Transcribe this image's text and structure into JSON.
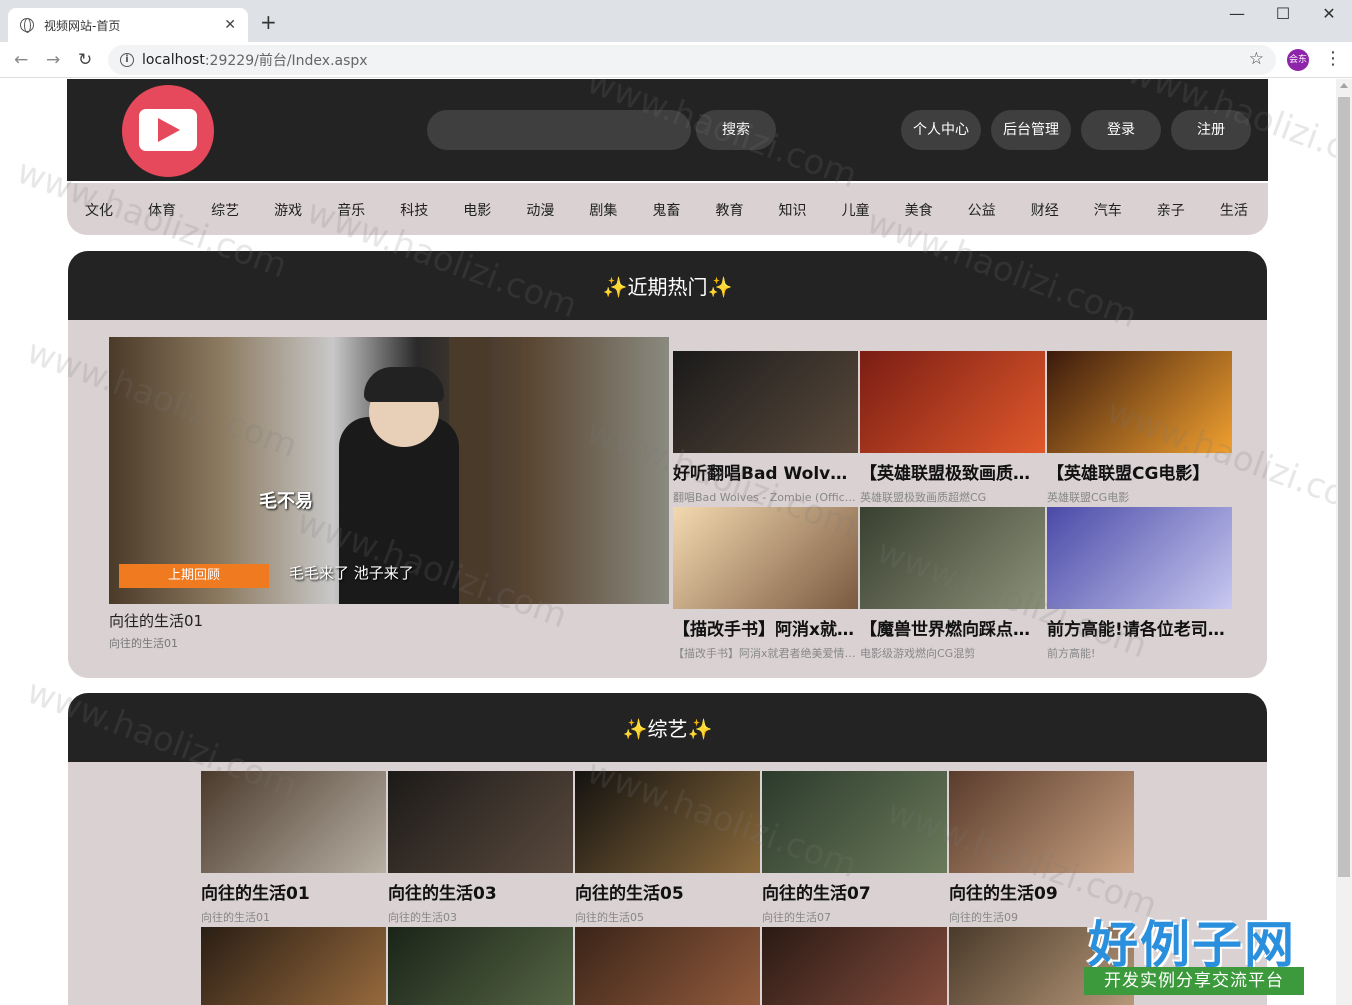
{
  "browser": {
    "tab_title": "视频网站-首页",
    "tab_close": "✕",
    "new_tab": "+",
    "url_host": "localhost",
    "url_rest": ":29229/前台/Index.aspx",
    "profile_label": "会东",
    "minimize": "—",
    "maximize": "☐",
    "close": "✕"
  },
  "header": {
    "search_placeholder": "",
    "search_button": "搜索",
    "user_center": "个人中心",
    "admin": "后台管理",
    "login": "登录",
    "register": "注册"
  },
  "categories": [
    "文化",
    "体育",
    "综艺",
    "游戏",
    "音乐",
    "科技",
    "电影",
    "动漫",
    "剧集",
    "鬼畜",
    "教育",
    "知识",
    "儿童",
    "美食",
    "公益",
    "财经",
    "汽车",
    "亲子",
    "生活"
  ],
  "hot": {
    "heading": "近期热门",
    "sparkle": "✨",
    "main": {
      "title": "向往的生活01",
      "subtitle": "向往的生活01",
      "overlay_badge": "上期回顾",
      "overlay_caption": "毛毛来了 池子来了",
      "overlay_tag": "毛不易"
    },
    "items": [
      {
        "title": "好听翻唱Bad Wolves - Zombie",
        "subtitle": "翻唱Bad Wolves - Zombie (Official)",
        "colors": [
          "#1a1a1a",
          "#5a4a3c"
        ]
      },
      {
        "title": "【英雄联盟极致画质燃向混剪】",
        "subtitle": "英雄联盟极致画质超燃CG",
        "colors": [
          "#7a1d14",
          "#e0592b"
        ]
      },
      {
        "title": "【英雄联盟CG电影】",
        "subtitle": "英雄联盟CG电影",
        "colors": [
          "#3b1a0c",
          "#f0a030"
        ]
      },
      {
        "title": "【描改手书】阿消x就君者绝美爱情",
        "subtitle": "【描改手书】阿消x就君者绝美爱情故事",
        "colors": [
          "#f3d9b0",
          "#7a5a40"
        ]
      },
      {
        "title": "【魔兽世界燃向踩点混剪】",
        "subtitle": "电影级游戏燃向CG混剪",
        "colors": [
          "#3a4030",
          "#8a9078"
        ]
      },
      {
        "title": "前方高能!请各位老司机坐稳",
        "subtitle": "前方高能!",
        "colors": [
          "#4a4aa8",
          "#c8c8f0"
        ]
      }
    ]
  },
  "variety": {
    "heading": "综艺",
    "sparkle": "✨",
    "items": [
      {
        "title": "向往的生活01",
        "subtitle": "向往的生活01",
        "colors": [
          "#4a3a2c",
          "#b8b0a4"
        ]
      },
      {
        "title": "向往的生活03",
        "subtitle": "向往的生活03",
        "colors": [
          "#1c1a18",
          "#5a4a3e"
        ]
      },
      {
        "title": "向往的生活05",
        "subtitle": "向往的生活05",
        "colors": [
          "#141210",
          "#8a6a3c"
        ]
      },
      {
        "title": "向往的生活07",
        "subtitle": "向往的生活07",
        "colors": [
          "#2c3a2c",
          "#6a7a5a"
        ]
      },
      {
        "title": "向往的生活09",
        "subtitle": "向往的生活09",
        "colors": [
          "#5a3c2c",
          "#c8a080"
        ]
      },
      {
        "title": "",
        "subtitle": "",
        "colors": [
          "#2a1e14",
          "#a07040"
        ]
      },
      {
        "title": "",
        "subtitle": "",
        "colors": [
          "#1a2418",
          "#5a6a48"
        ]
      },
      {
        "title": "",
        "subtitle": "",
        "colors": [
          "#3a2418",
          "#9a6040"
        ]
      },
      {
        "title": "",
        "subtitle": "",
        "colors": [
          "#2a1a14",
          "#8a5040"
        ]
      },
      {
        "title": "",
        "subtitle": "",
        "colors": [
          "#4a3a2a",
          "#c0a080"
        ]
      }
    ]
  },
  "watermark": {
    "text": "www.haolizi.com",
    "logo_big": "好例子网",
    "logo_small": "开发实例分享交流平台"
  }
}
